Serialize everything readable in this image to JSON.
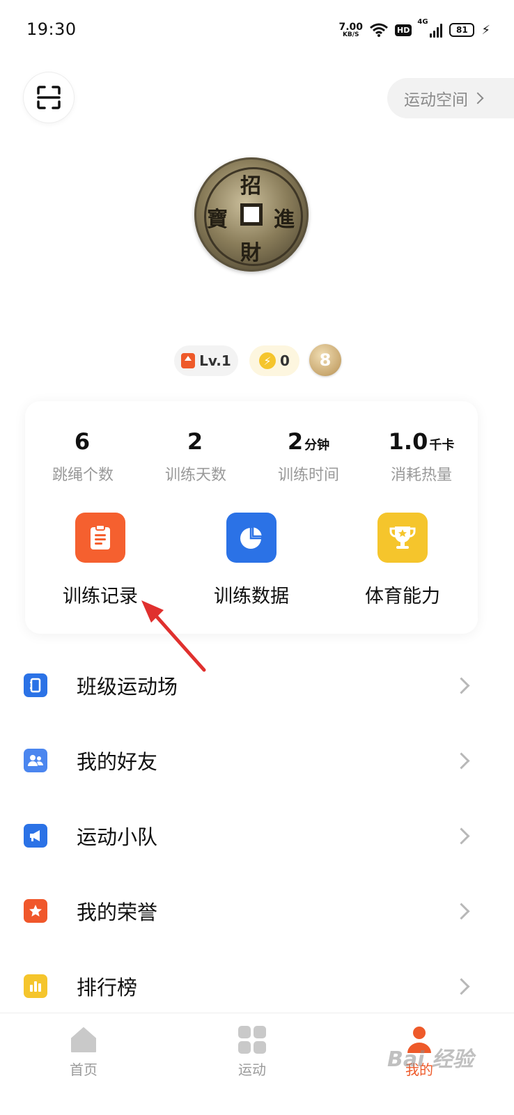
{
  "status_bar": {
    "time": "19:30",
    "net_speed_value": "7.00",
    "net_speed_unit": "KB/S",
    "hd": "HD",
    "network": "4G",
    "battery": "81"
  },
  "header": {
    "scan_icon": "scan-icon",
    "space_label": "运动空间"
  },
  "profile": {
    "avatar_chars": [
      "招",
      "進",
      "財",
      "寶"
    ],
    "level": "Lv.1",
    "energy": "0",
    "medal_glyph": "8"
  },
  "stats": [
    {
      "value": "6",
      "unit": "",
      "label": "跳绳个数"
    },
    {
      "value": "2",
      "unit": "",
      "label": "训练天数"
    },
    {
      "value": "2",
      "unit": "分钟",
      "label": "训练时间"
    },
    {
      "value": "1.0",
      "unit": "千卡",
      "label": "消耗热量"
    }
  ],
  "features": [
    {
      "label": "训练记录",
      "icon": "clipboard-icon",
      "color": "#f5602f"
    },
    {
      "label": "训练数据",
      "icon": "pie-chart-icon",
      "color": "#2b72e6"
    },
    {
      "label": "体育能力",
      "icon": "trophy-icon",
      "color": "#f5c52c"
    }
  ],
  "menu": [
    {
      "label": "班级运动场",
      "icon": "notebook-icon",
      "color": "#2b72e6"
    },
    {
      "label": "我的好友",
      "icon": "friends-icon",
      "color": "#4b86ef"
    },
    {
      "label": "运动小队",
      "icon": "megaphone-icon",
      "color": "#2b72e6"
    },
    {
      "label": "我的荣誉",
      "icon": "star-badge-icon",
      "color": "#f0572b"
    },
    {
      "label": "排行榜",
      "icon": "bar-chart-icon",
      "color": "#f5c52c"
    }
  ],
  "bottom_nav": [
    {
      "label": "首页",
      "icon": "home-icon",
      "active": false
    },
    {
      "label": "运动",
      "icon": "grid-icon",
      "active": false
    },
    {
      "label": "我的",
      "icon": "profile-icon",
      "active": true
    }
  ],
  "watermark": "Bai 经验",
  "colors": {
    "accent": "#ee5a2a",
    "annotation_arrow": "#e0302e"
  }
}
